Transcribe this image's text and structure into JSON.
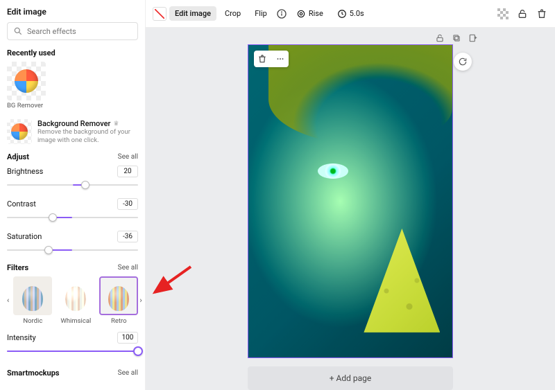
{
  "panel": {
    "title": "Edit image"
  },
  "search": {
    "placeholder": "Search effects"
  },
  "recently_used": {
    "heading": "Recently used",
    "items": [
      {
        "label": "BG Remover"
      }
    ]
  },
  "bg_remover": {
    "title": "Background Remover",
    "desc": "Remove the background of your image with one click."
  },
  "adjust": {
    "heading": "Adjust",
    "see_all": "See all",
    "sliders": [
      {
        "label": "Brightness",
        "value": "20"
      },
      {
        "label": "Contrast",
        "value": "-30"
      },
      {
        "label": "Saturation",
        "value": "-36"
      }
    ]
  },
  "filters": {
    "heading": "Filters",
    "see_all": "See all",
    "items": [
      {
        "name": "Nordic"
      },
      {
        "name": "Whimsical"
      },
      {
        "name": "Retro"
      }
    ],
    "intensity": {
      "label": "Intensity",
      "value": "100"
    }
  },
  "smartmockups": {
    "heading": "Smartmockups",
    "see_all": "See all"
  },
  "toolbar": {
    "edit_image": "Edit image",
    "crop": "Crop",
    "flip": "Flip",
    "animation": "Rise",
    "duration": "5.0s"
  },
  "canvas": {
    "add_page": "+ Add page"
  }
}
